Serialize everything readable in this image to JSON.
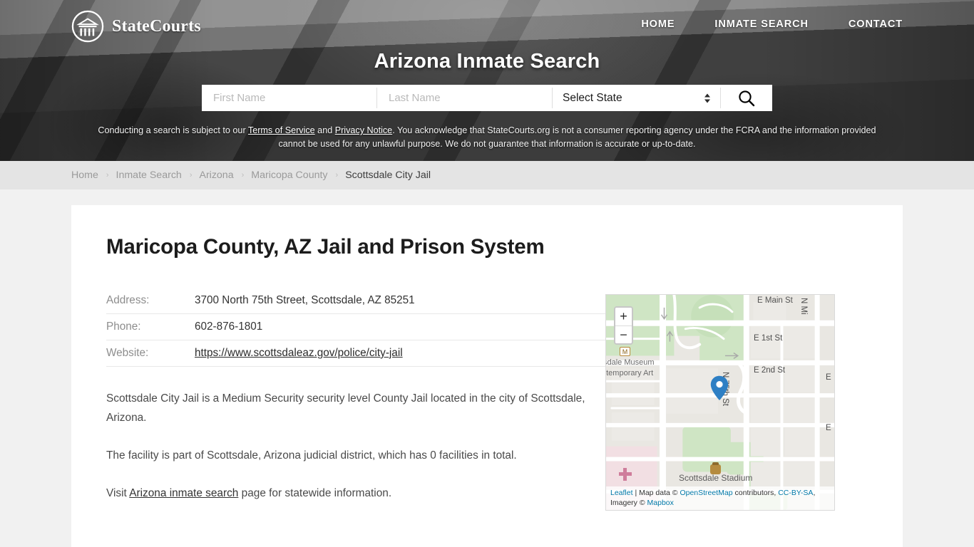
{
  "site": {
    "logo_text": "StateCourts",
    "logo_icon": "courthouse-circle-icon"
  },
  "nav": {
    "items": [
      {
        "label": "HOME"
      },
      {
        "label": "INMATE SEARCH"
      },
      {
        "label": "CONTACT"
      }
    ]
  },
  "hero": {
    "title": "Arizona Inmate Search"
  },
  "search": {
    "first_name_placeholder": "First Name",
    "first_name_value": "",
    "last_name_placeholder": "Last Name",
    "last_name_value": "",
    "state_selected": "Select State",
    "search_icon": "magnifier-icon"
  },
  "disclaimer": {
    "part1": "Conducting a search is subject to our ",
    "terms_link": "Terms of Service",
    "part2": " and ",
    "privacy_link": "Privacy Notice",
    "part3": ". You acknowledge that StateCourts.org is not a consumer reporting agency under the FCRA and the information provided cannot be used for any unlawful purpose. We do not guarantee that information is accurate or up-to-date."
  },
  "breadcrumb": {
    "items": [
      {
        "label": "Home",
        "current": false
      },
      {
        "label": "Inmate Search",
        "current": false
      },
      {
        "label": "Arizona",
        "current": false
      },
      {
        "label": "Maricopa County",
        "current": false
      },
      {
        "label": "Scottsdale City Jail",
        "current": true
      }
    ],
    "separator": "›"
  },
  "main": {
    "page_title": "Maricopa County, AZ Jail and Prison System",
    "info_rows": [
      {
        "label": "Address:",
        "value": "3700 North 75th Street, Scottsdale, AZ 85251",
        "is_link": false
      },
      {
        "label": "Phone:",
        "value": "602-876-1801",
        "is_link": false
      },
      {
        "label": "Website:",
        "value": "https://www.scottsdaleaz.gov/police/city-jail",
        "is_link": true
      }
    ],
    "paragraph1": "Scottsdale City Jail is a Medium Security security level County Jail located in the city of Scottsdale, Arizona.",
    "paragraph2": "The facility is part of Scottsdale, Arizona judicial district, which has 0 facilities in total.",
    "paragraph3_before": "Visit ",
    "paragraph3_link": "Arizona inmate search",
    "paragraph3_after": " page for statewide information."
  },
  "map": {
    "zoom_in_label": "+",
    "zoom_out_label": "−",
    "marker_label": "location-marker",
    "labels": {
      "museum_line1": "sdale Museum",
      "museum_line2": "ntemporary Art",
      "main_st": "E Main St",
      "first_st": "E 1st St",
      "second_st": "E 2nd St",
      "n_miller": "N Mi",
      "n_75th": "N 75th St",
      "stadium": "Scottsdale Stadium",
      "edge_label_1": "E",
      "edge_label_2": "E",
      "museum_icon_glyph": "M"
    },
    "attribution": {
      "leaflet": "Leaflet",
      "sep1": " | Map data © ",
      "osm": "OpenStreetMap",
      "sep2": " contributors, ",
      "ccbysa": "CC-BY-SA",
      "sep3": ", Imagery © ",
      "mapbox": "Mapbox"
    }
  },
  "colors": {
    "header_bg": "#4a4a4a",
    "crumb_bg": "#e4e4e4",
    "page_bg": "#f1f1f1",
    "marker_blue": "#2e7fc4",
    "link_blue": "#0078a8",
    "map_park_green": "#cfe5c4"
  }
}
